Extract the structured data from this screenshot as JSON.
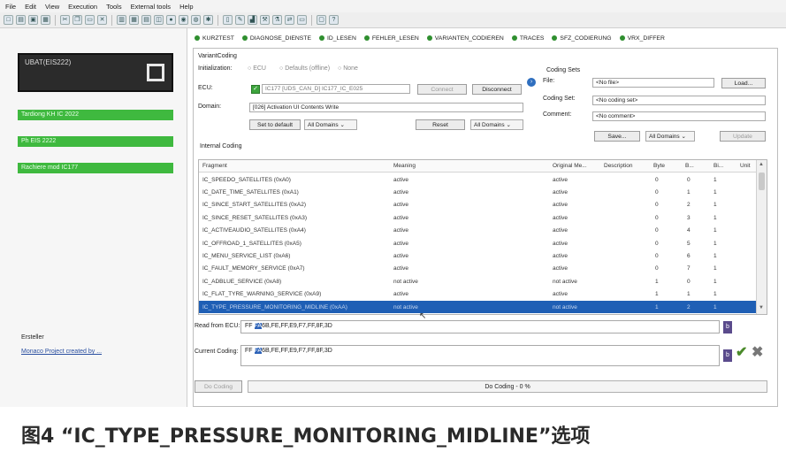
{
  "menu": [
    "File",
    "Edit",
    "View",
    "Execution",
    "Tools",
    "External tools",
    "Help"
  ],
  "left_panel": {
    "ubat_label": "UBAT(EIS222)",
    "status_bars": [
      "Tardiong KH IC 2022",
      "Ph EIS 2222",
      "Rachiere mod IC177"
    ],
    "footer_label": "Ersteller",
    "footer_link": "Monaco Project created by ..."
  },
  "tabs": [
    "KURZTEST",
    "DIAGNOSE_DIENSTE",
    "ID_LESEN",
    "FEHLER_LESEN",
    "VARIANTEN_CODIEREN",
    "TRACES",
    "SFZ_CODIERUNG",
    "VRX_DIFFER"
  ],
  "variant_coding": {
    "group_title": "VariantCoding",
    "init_label": "Initialization:",
    "init_options": [
      "ECU",
      "Defaults (offline)",
      "None"
    ],
    "ecu_label": "ECU:",
    "ecu_value": "IC177 [UDS_CAN_D] IC177_IC_E025",
    "connect_label": "Connect",
    "disconnect_label": "Disconnect",
    "domain_label": "Domain:",
    "domain_value": "[026] Activation UI Contents Write",
    "set_default_label": "Set to default",
    "all_domains_label": "All Domains",
    "reset_label": "Reset",
    "all_domains_right_label": "All Domains",
    "internal_coding_label": "Internal Coding"
  },
  "coding_sets": {
    "title": "Coding Sets",
    "file_label": "File:",
    "file_value": "<No file>",
    "load_label": "Load...",
    "coding_set_label": "Coding Set:",
    "coding_set_value": "<No coding set>",
    "comment_label": "Comment:",
    "comment_value": "<No comment>",
    "save_label": "Save...",
    "all_domains_label": "All Domains",
    "update_label": "Update"
  },
  "table": {
    "headers": [
      "Fragment",
      "Meaning",
      "Original Me...",
      "Description",
      "Byte",
      "B...",
      "Bi...",
      "Unit"
    ],
    "rows": [
      {
        "fragment": "IC_SPEEDO_SATELLITES (0xA0)",
        "meaning": "active",
        "original": "active",
        "byte": "0",
        "b": "0",
        "bi": "1"
      },
      {
        "fragment": "IC_DATE_TIME_SATELLITES (0xA1)",
        "meaning": "active",
        "original": "active",
        "byte": "0",
        "b": "1",
        "bi": "1"
      },
      {
        "fragment": "IC_SINCE_START_SATELLITES (0xA2)",
        "meaning": "active",
        "original": "active",
        "byte": "0",
        "b": "2",
        "bi": "1"
      },
      {
        "fragment": "IC_SINCE_RESET_SATELLITES (0xA3)",
        "meaning": "active",
        "original": "active",
        "byte": "0",
        "b": "3",
        "bi": "1"
      },
      {
        "fragment": "IC_ACTIVEAUDIO_SATELLITES (0xA4)",
        "meaning": "active",
        "original": "active",
        "byte": "0",
        "b": "4",
        "bi": "1"
      },
      {
        "fragment": "IC_OFFROAD_1_SATELLITES (0xA5)",
        "meaning": "active",
        "original": "active",
        "byte": "0",
        "b": "5",
        "bi": "1"
      },
      {
        "fragment": "IC_MENU_SERVICE_LIST (0xA6)",
        "meaning": "active",
        "original": "active",
        "byte": "0",
        "b": "6",
        "bi": "1"
      },
      {
        "fragment": "IC_FAULT_MEMORY_SERVICE (0xA7)",
        "meaning": "active",
        "original": "active",
        "byte": "0",
        "b": "7",
        "bi": "1"
      },
      {
        "fragment": "IC_ADBLUE_SERVICE (0xA8)",
        "meaning": "not active",
        "original": "not active",
        "byte": "1",
        "b": "0",
        "bi": "1"
      },
      {
        "fragment": "IC_FLAT_TYRE_WARNING_SERVICE (0xA9)",
        "meaning": "active",
        "original": "active",
        "byte": "1",
        "b": "1",
        "bi": "1"
      },
      {
        "fragment": "IC_TYPE_PRESSURE_MONITORING_MIDLINE (0xAA)",
        "meaning": "not active",
        "original": "not active",
        "byte": "1",
        "b": "2",
        "bi": "1"
      }
    ]
  },
  "read_from_ecu": {
    "label": "Read from ECU:",
    "highlight": "FA",
    "prefix": "FF",
    "rest": "6B,FE,FF,E9,F7,FF,8F,3D"
  },
  "current_coding": {
    "label": "Current Coding:",
    "highlight": "FA",
    "prefix": "FF",
    "rest": "6B,FE,FF,E9,F7,FF,8F,3D"
  },
  "bottom": {
    "do_coding_button": "Do Coding",
    "progress_text": "Do Coding - 0 %"
  },
  "caption": "图4 “IC_TYPE_PRESSURE_MONITORING_MIDLINE”选项"
}
